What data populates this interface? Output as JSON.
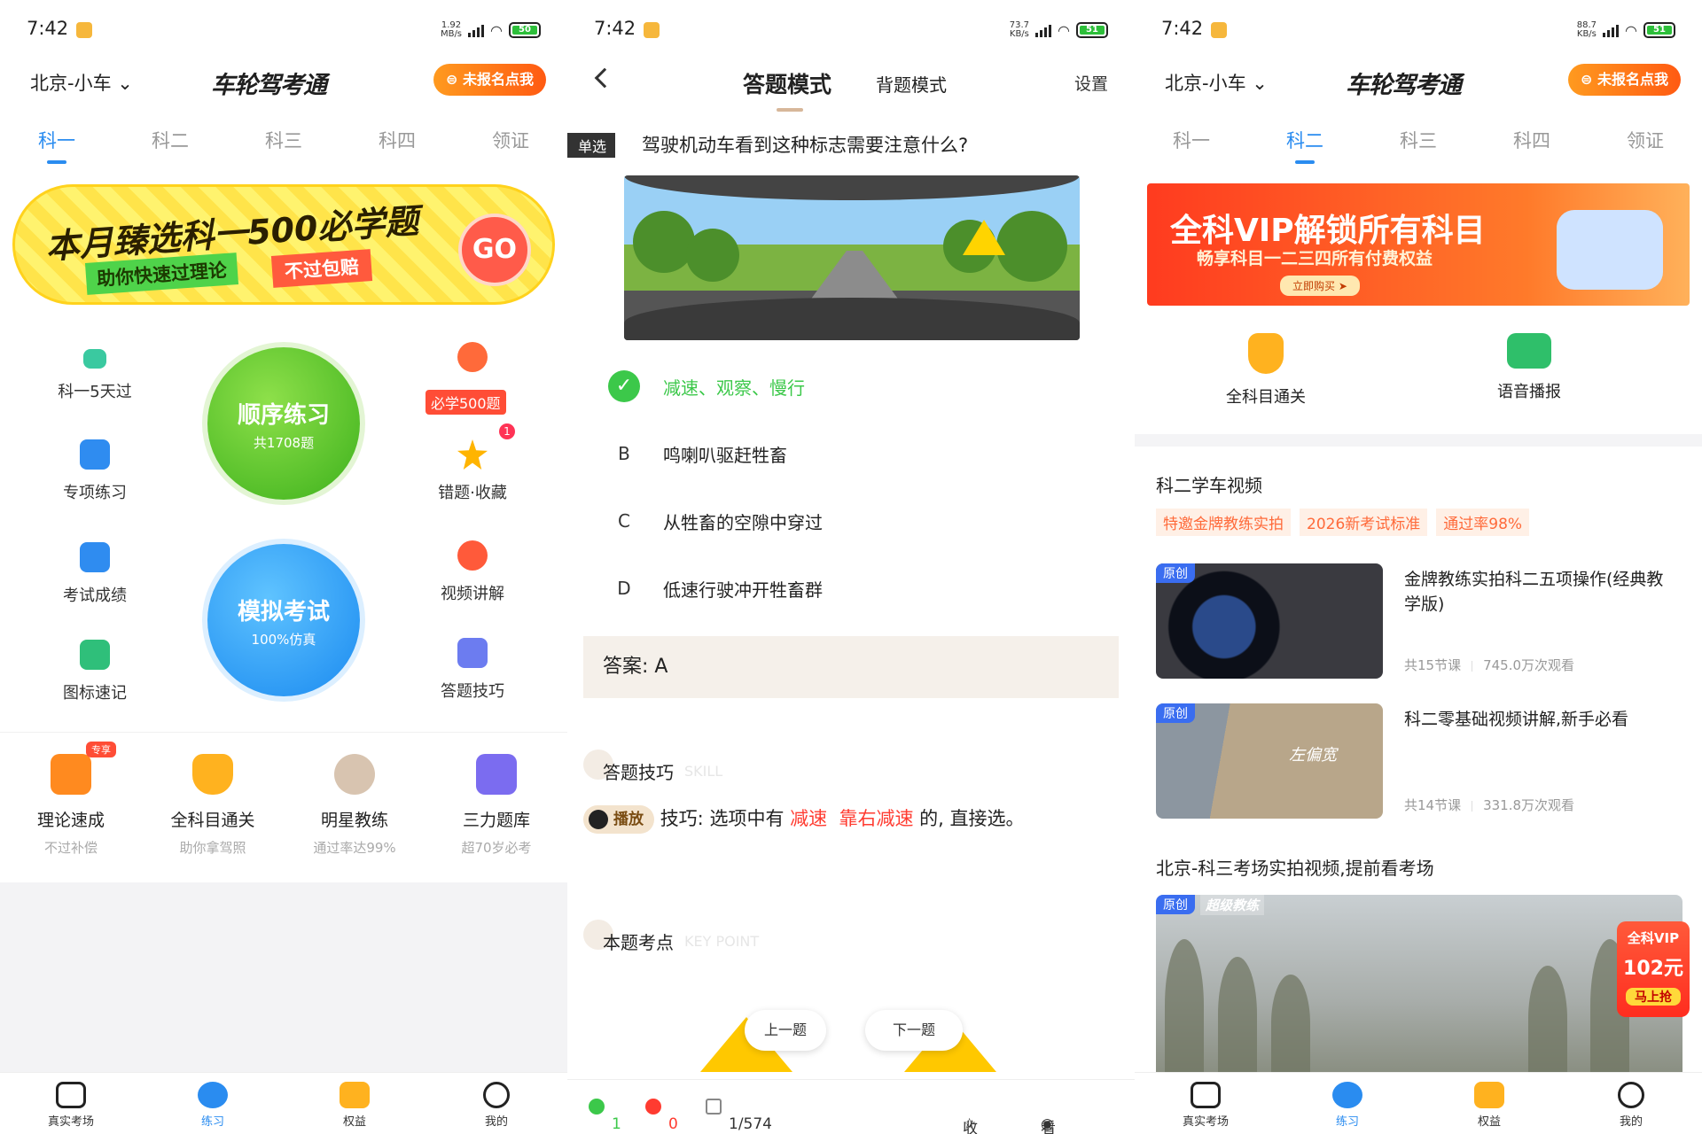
{
  "colors": {
    "accent": "#2a8cf0",
    "orange": "#ff6a1a",
    "green": "#3cc84a",
    "red": "#ff3b30"
  },
  "status": [
    {
      "time": "7:42",
      "speed": "1.92\nMB/s",
      "battery": "50"
    },
    {
      "time": "7:42",
      "speed": "73.7\nKB/s",
      "battery": "51"
    },
    {
      "time": "7:42",
      "speed": "88.7\nKB/s",
      "battery": "51"
    }
  ],
  "header": {
    "city": "北京-小车",
    "logo": "车轮驾考通",
    "sign_btn": "未报名点我"
  },
  "subject_tabs": [
    "科一",
    "科二",
    "科三",
    "科四",
    "领证"
  ],
  "s1": {
    "banner": {
      "title": "本月臻选科一500必学题",
      "sub1": "助你快速过理论",
      "sub2": "不过包赔",
      "go": "GO"
    },
    "grid": {
      "k1_5days": "科一5天过",
      "special": "专项练习",
      "scores": "考试成绩",
      "signs": "图标速记",
      "must500": "必学500题",
      "wrong_fav": "错题·收藏",
      "video": "视频讲解",
      "tips": "答题技巧",
      "wrong_badge": "1"
    },
    "order": {
      "title": "顺序练习",
      "count": "共1708题"
    },
    "mock": {
      "title": "模拟考试",
      "sub": "100%仿真"
    },
    "row": [
      {
        "title": "理论速成",
        "sub": "不过补偿",
        "badge": "专享"
      },
      {
        "title": "全科目通关",
        "sub": "助你拿驾照"
      },
      {
        "title": "明星教练",
        "sub": "通过率达99%"
      },
      {
        "title": "三力题库",
        "sub": "超70岁必考"
      }
    ]
  },
  "nav": [
    "真实考场",
    "练习",
    "权益",
    "我的"
  ],
  "s2": {
    "mode_answer": "答题模式",
    "mode_recite": "背题模式",
    "settings": "设置",
    "qtype": "单选",
    "question": "驾驶机动车看到这种标志需要注意什么?",
    "options": [
      {
        "key": "✓",
        "text": "减速、观察、慢行"
      },
      {
        "key": "B",
        "text": "鸣喇叭驱赶牲畜"
      },
      {
        "key": "C",
        "text": "从牲畜的空隙中穿过"
      },
      {
        "key": "D",
        "text": "低速行驶冲开牲畜群"
      }
    ],
    "answer": "答案: A",
    "skill_title": "答题技巧",
    "skill_en": "SKILL",
    "play": "播放",
    "tip_pre": "技巧: 选项中有 ",
    "tip_kw1": "减速",
    "tip_kw2": "靠右减速",
    "tip_post": " 的, 直接选。",
    "keypoint_title": "本题考点",
    "keypoint_en": "KEY POINT",
    "prev": "上一题",
    "next": "下一题",
    "correct": "1",
    "wrong": "0",
    "progress": "1/574",
    "fav": "收藏",
    "view_answer": "看答案"
  },
  "s3": {
    "vip_title": "全科VIP解锁所有科目",
    "vip_sub": "畅享科目一二三四所有付费权益",
    "vip_btn": "立即购买 ➤",
    "quick": [
      "全科目通关",
      "语音播报"
    ],
    "sec_title": "科二学车视频",
    "tags": [
      "特邀金牌教练实拍",
      "2026新考试标准",
      "通过率98%"
    ],
    "videos": [
      {
        "badge": "原创",
        "title": "金牌教练实拍科二五项操作(经典教学版)",
        "lessons": "共15节课",
        "views": "745.0万次观看"
      },
      {
        "badge": "原创",
        "title": "科二零基础视频讲解,新手必看",
        "lessons": "共14节课",
        "views": "331.8万次观看",
        "overlay": "左偏宽"
      }
    ],
    "sec2_title": "北京-科三考场实拍视频,提前看考场",
    "big_badge": "原创",
    "big_coach": "超级教练",
    "sticker": {
      "a": "全科VIP",
      "b": "102元",
      "c": "马上抢"
    }
  }
}
